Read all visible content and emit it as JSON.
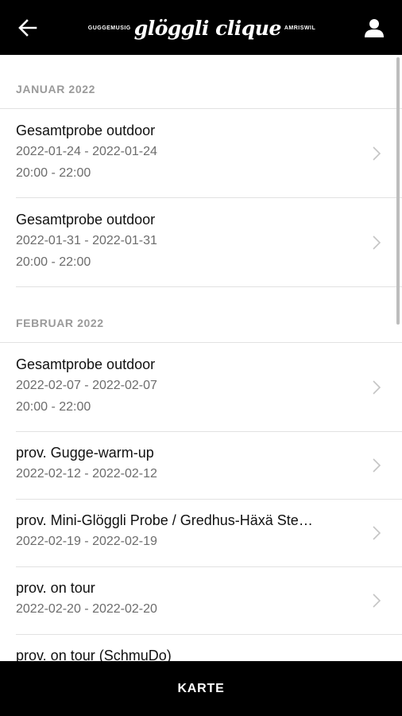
{
  "header": {
    "logo_left": "GUGGEMUSIG",
    "logo_main": "glöggli clique",
    "logo_right": "AMRISWIL"
  },
  "sections": [
    {
      "label": "JANUAR 2022",
      "items": [
        {
          "title": "Gesamtprobe outdoor",
          "dates": "2022-01-24 - 2022-01-24",
          "time": "20:00 - 22:00"
        },
        {
          "title": "Gesamtprobe outdoor",
          "dates": "2022-01-31 - 2022-01-31",
          "time": "20:00 - 22:00"
        }
      ]
    },
    {
      "label": "FEBRUAR 2022",
      "items": [
        {
          "title": "Gesamtprobe outdoor",
          "dates": "2022-02-07 - 2022-02-07",
          "time": "20:00 - 22:00"
        },
        {
          "title": "prov. Gugge-warm-up",
          "dates": "2022-02-12 - 2022-02-12"
        },
        {
          "title": "prov. Mini-Glöggli Probe / Gredhus-Häxä Ste…",
          "dates": "2022-02-19 - 2022-02-19"
        },
        {
          "title": "prov. on tour",
          "dates": "2022-02-20 - 2022-02-20"
        },
        {
          "title": "prov. on tour (SchmuDo)"
        }
      ]
    }
  ],
  "footer": {
    "label": "KARTE"
  },
  "icons": {
    "back": "arrow-left-icon",
    "user": "user-icon",
    "chevron": "chevron-right-icon"
  },
  "colors": {
    "bar": "#000000",
    "section_label": "#9a9a9a",
    "subtext": "#6c6c6c",
    "divider": "#e2e2e2"
  }
}
